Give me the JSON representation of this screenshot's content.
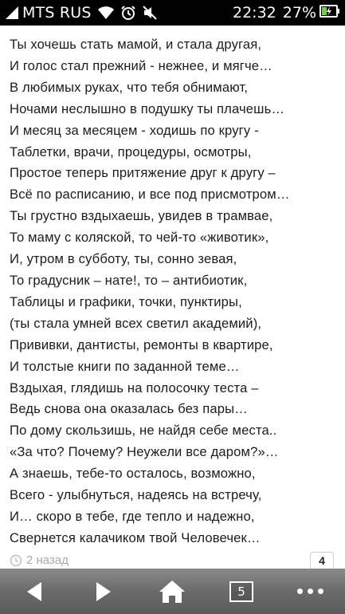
{
  "statusbar": {
    "carrier": "MTS RUS",
    "time": "22:32",
    "battery_percent": "27%",
    "icons": [
      "signal-icon",
      "wifi-icon",
      "alarm-icon",
      "mute-icon",
      "battery-charging-icon"
    ]
  },
  "poem": {
    "lines": [
      "Ты хочешь стать мамой, и стала другая,",
      "И голос стал прежний - нежнее, и мягче…",
      "В любимых руках, что тебя обнимают,",
      "Ночами неслышно в подушку ты плачешь…",
      "И месяц за месяцем - ходишь по кругу -",
      "Таблетки, врачи, процедуры, осмотры,",
      "Простое теперь притяжение друг к другу –",
      "Всё по расписанию, и все под присмотром…",
      "Ты грустно вздыхаешь, увидев в трамвае,",
      "То маму с коляской, то чей-то «животик»,",
      "И, утром в субботу, ты, сонно зевая,",
      "То градусник – нате!, то – антибиотик,",
      "Таблицы и графики, точки, пунктиры,",
      "(ты стала умней всех светил академий),",
      "Прививки, дантисты, ремонты в квартире,",
      "И толстые книги по заданной теме…",
      "Вздыхая, глядишь на полосочку теста –",
      "Ведь снова она оказалась без пары…",
      "По дому скользишь, не найдя себе места..",
      "«За что? Почему? Неужели все даром?»…",
      "А знаешь, тебе-то осталось, возможно,",
      "Всего - улыбнуться, надеясь на встречу,",
      "И… скоро в тебе, где тепло и надежно,",
      "Свернется калачиком твой Человечек…"
    ]
  },
  "meta": {
    "time_ago": "2 назад",
    "count": "4"
  },
  "navbar": {
    "tabs_count": "5",
    "buttons": [
      "back-icon",
      "forward-icon",
      "home-icon",
      "tabs-icon",
      "more-icon"
    ]
  },
  "colors": {
    "statusbar_bg": "#000000",
    "text": "#1c1c1c",
    "meta_text": "#a8a8a8",
    "navbar_bg": "#6a6a6a"
  }
}
